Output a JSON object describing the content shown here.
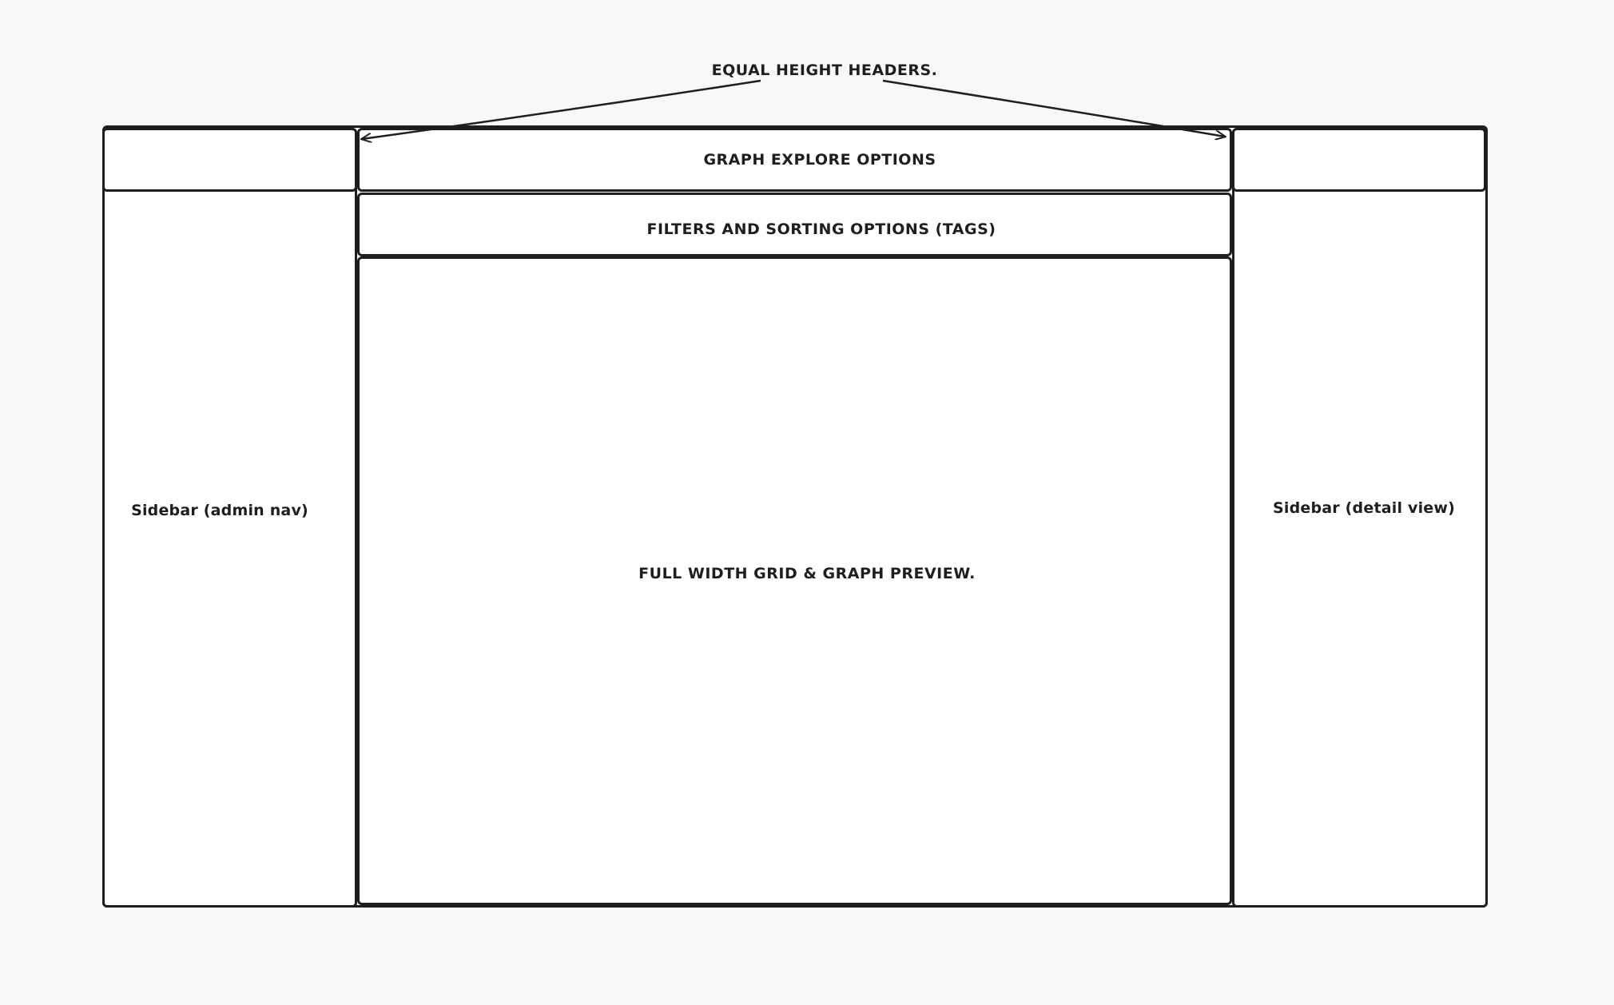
{
  "diagram": {
    "annotation": "EQUAL HEIGHT HEADERS.",
    "center_header": "GRAPH EXPLORE OPTIONS",
    "filters_bar": "FILTERS AND SORTING OPTIONS (TAGS)",
    "main_area": "FULL WIDTH GRID & GRAPH PREVIEW.",
    "left_sidebar": "Sidebar (admin nav)",
    "right_sidebar": "Sidebar (detail view)"
  },
  "colors": {
    "background": "#f8f8fa",
    "stroke": "#1e1e1e",
    "panel": "#ffffff"
  }
}
